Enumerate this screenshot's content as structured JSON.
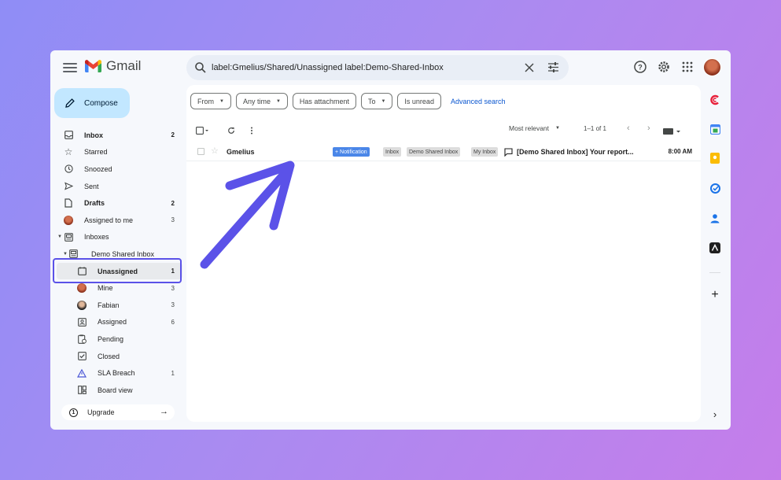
{
  "app": {
    "name": "Gmail"
  },
  "search": {
    "query": "label:Gmelius/Shared/Unassigned label:Demo-Shared-Inbox"
  },
  "compose": {
    "label": "Compose"
  },
  "nav": {
    "inbox": {
      "label": "Inbox",
      "count": "2"
    },
    "starred": {
      "label": "Starred"
    },
    "snoozed": {
      "label": "Snoozed"
    },
    "sent": {
      "label": "Sent"
    },
    "drafts": {
      "label": "Drafts",
      "count": "2"
    },
    "assigned_to_me": {
      "label": "Assigned to me",
      "count": "3"
    },
    "inboxes": {
      "label": "Inboxes"
    },
    "demo_shared_inbox": {
      "label": "Demo Shared Inbox"
    },
    "unassigned": {
      "label": "Unassigned",
      "count": "1"
    },
    "mine": {
      "label": "Mine",
      "count": "3"
    },
    "fabian": {
      "label": "Fabian",
      "count": "3"
    },
    "assigned": {
      "label": "Assigned",
      "count": "6"
    },
    "pending": {
      "label": "Pending"
    },
    "closed": {
      "label": "Closed"
    },
    "sla_breach": {
      "label": "SLA Breach",
      "count": "1"
    },
    "board_view": {
      "label": "Board view"
    }
  },
  "upgrade": {
    "label": "Upgrade"
  },
  "filters": {
    "from": "From",
    "any_time": "Any time",
    "has_attachment": "Has attachment",
    "to": "To",
    "is_unread": "Is unread",
    "advanced_search": "Advanced search"
  },
  "toolbar": {
    "sort": "Most relevant",
    "range": "1–1 of 1"
  },
  "email": {
    "sender": "Gmelius",
    "labels": [
      "+ Notification",
      "Inbox",
      "Demo Shared Inbox",
      "My Inbox"
    ],
    "subject": "[Demo Shared Inbox] Your report...",
    "time": "8:00 AM"
  },
  "colors": {
    "accent": "#5b52e8",
    "compose_bg": "#c2e7ff",
    "notification_tag": "#4a86e8"
  },
  "icons": {
    "rail": [
      "gmelius-icon",
      "calendar-icon",
      "keep-icon",
      "tasks-icon",
      "contacts-icon",
      "addon-icon",
      "add-icon"
    ]
  }
}
